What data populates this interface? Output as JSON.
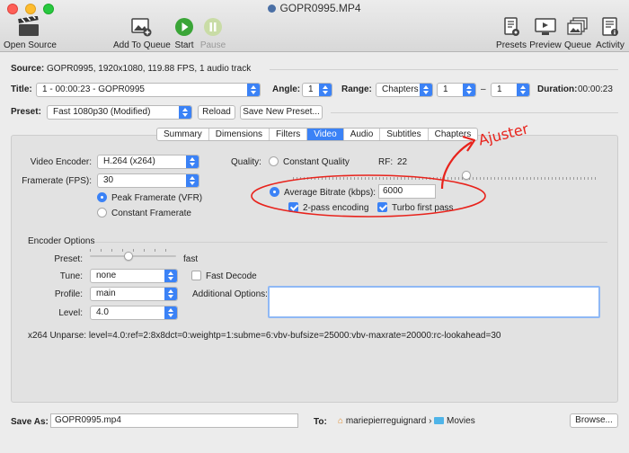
{
  "window": {
    "title": "GOPR0995.MP4"
  },
  "toolbar": {
    "open_source": "Open Source",
    "add_to_queue": "Add To Queue",
    "start": "Start",
    "pause": "Pause",
    "presets": "Presets",
    "preview": "Preview",
    "queue": "Queue",
    "activity": "Activity"
  },
  "source": {
    "label": "Source:",
    "value": "GOPR0995, 1920x1080, 119.88 FPS, 1 audio track"
  },
  "title_row": {
    "label": "Title:",
    "value": "1 - 00:00:23 - GOPR0995",
    "angle_label": "Angle:",
    "angle": "1",
    "range_label": "Range:",
    "range_type": "Chapters",
    "range_from": "1",
    "range_dash": "–",
    "range_to": "1",
    "duration_label": "Duration:",
    "duration": "00:00:23"
  },
  "preset_row": {
    "label": "Preset:",
    "value": "Fast 1080p30 (Modified)",
    "reload": "Reload",
    "save_new": "Save New Preset..."
  },
  "tabs": [
    {
      "label": "Summary",
      "active": false
    },
    {
      "label": "Dimensions",
      "active": false
    },
    {
      "label": "Filters",
      "active": false
    },
    {
      "label": "Video",
      "active": true
    },
    {
      "label": "Audio",
      "active": false
    },
    {
      "label": "Subtitles",
      "active": false
    },
    {
      "label": "Chapters",
      "active": false
    }
  ],
  "video": {
    "encoder_label": "Video Encoder:",
    "encoder": "H.264 (x264)",
    "framerate_label": "Framerate (FPS):",
    "framerate": "30",
    "peak_framerate": "Peak Framerate (VFR)",
    "constant_framerate": "Constant Framerate",
    "quality_label": "Quality:",
    "constant_quality": "Constant Quality",
    "rf_label": "RF:",
    "rf_value": "22",
    "avg_bitrate": "Average Bitrate (kbps):",
    "bitrate_value": "6000",
    "two_pass": "2-pass encoding",
    "turbo_first": "Turbo first pass"
  },
  "encoder_options": {
    "heading": "Encoder Options",
    "preset_label": "Preset:",
    "preset_value": "fast",
    "tune_label": "Tune:",
    "tune": "none",
    "fast_decode": "Fast Decode",
    "profile_label": "Profile:",
    "profile": "main",
    "additional_label": "Additional Options:",
    "level_label": "Level:",
    "level": "4.0"
  },
  "unparse": "x264 Unparse: level=4.0:ref=2:8x8dct=0:weightp=1:subme=6:vbv-bufsize=25000:vbv-maxrate=20000:rc-lookahead=30",
  "save": {
    "label": "Save As:",
    "filename": "GOPR0995.mp4",
    "to_label": "To:",
    "user": "mariepierreguignard",
    "chevron": "›",
    "folder": "Movies",
    "browse": "Browse..."
  },
  "annotation": {
    "text": "Ajuster",
    "color": "#e8231c"
  },
  "colors": {
    "accent": "#3b82f6",
    "annotation": "#e8231c"
  }
}
